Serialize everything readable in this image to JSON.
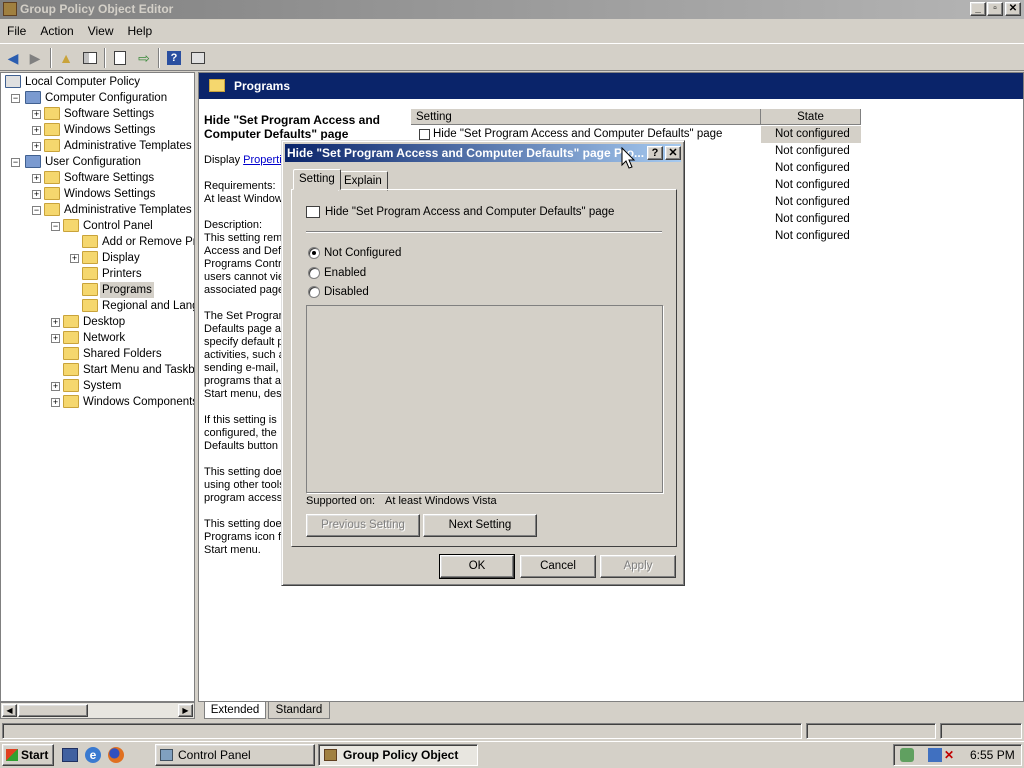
{
  "window": {
    "title": "Group Policy Object Editor",
    "min": "_",
    "max": "▫",
    "close": "✕"
  },
  "menu": [
    "File",
    "Action",
    "View",
    "Help"
  ],
  "tree": [
    {
      "label": "Local Computer Policy",
      "level": 0,
      "exp": ""
    },
    {
      "label": "Computer Configuration",
      "level": 1,
      "exp": "−"
    },
    {
      "label": "Software Settings",
      "level": 2,
      "exp": "+"
    },
    {
      "label": "Windows Settings",
      "level": 2,
      "exp": "+"
    },
    {
      "label": "Administrative Templates",
      "level": 2,
      "exp": "+"
    },
    {
      "label": "User Configuration",
      "level": 1,
      "exp": "−"
    },
    {
      "label": "Software Settings",
      "level": 2,
      "exp": "+"
    },
    {
      "label": "Windows Settings",
      "level": 2,
      "exp": "+"
    },
    {
      "label": "Administrative Templates",
      "level": 2,
      "exp": "−"
    },
    {
      "label": "Control Panel",
      "level": 3,
      "exp": "−"
    },
    {
      "label": "Add or Remove Pro",
      "level": 4,
      "exp": ""
    },
    {
      "label": "Display",
      "level": 4,
      "exp": "+"
    },
    {
      "label": "Printers",
      "level": 4,
      "exp": ""
    },
    {
      "label": "Programs",
      "level": 4,
      "exp": "",
      "selected": true
    },
    {
      "label": "Regional and Langu",
      "level": 4,
      "exp": ""
    },
    {
      "label": "Desktop",
      "level": 3,
      "exp": "+"
    },
    {
      "label": "Network",
      "level": 3,
      "exp": "+"
    },
    {
      "label": "Shared Folders",
      "level": 3,
      "exp": ""
    },
    {
      "label": "Start Menu and Taskba",
      "level": 3,
      "exp": ""
    },
    {
      "label": "System",
      "level": 3,
      "exp": "+"
    },
    {
      "label": "Windows Components",
      "level": 3,
      "exp": "+"
    }
  ],
  "pane": {
    "header": "Programs",
    "desc_title": "Hide \"Set Program Access and Computer Defaults\" page",
    "display_prefix": "Display ",
    "display_link": "Properti",
    "requirements_label": "Requirements:",
    "requirements_value": "At least Window",
    "description_label": "Description:",
    "desc_lines_1": [
      "This setting rem",
      "Access and Defa",
      "Programs Contro",
      "users cannot vie",
      "associated page"
    ],
    "desc_lines_2": [
      "The Set Program",
      "Defaults page al",
      "specify default p",
      "activities, such a",
      "sending e-mail, a",
      "programs that a",
      "Start menu, des"
    ],
    "desc_lines_3": [
      "If this setting is",
      "configured, the",
      "Defaults button"
    ],
    "desc_lines_4": [
      "This setting doe",
      "using other tools",
      "program access"
    ],
    "desc_lines_5": [
      "This setting doe",
      "Programs icon fr",
      "Start menu."
    ],
    "col_setting": "Setting",
    "col_state": "State",
    "rows": [
      {
        "setting": "Hide \"Set Program Access and Computer Defaults\" page",
        "state": "Not configured"
      },
      {
        "setting": "",
        "state": "Not configured"
      },
      {
        "setting": "",
        "state": "Not configured"
      },
      {
        "setting": "",
        "state": "Not configured"
      },
      {
        "setting": "",
        "state": "Not configured"
      },
      {
        "setting": "",
        "state": "Not configured"
      },
      {
        "setting": "",
        "state": "Not configured"
      }
    ]
  },
  "tabs_bottom": [
    "Extended",
    "Standard"
  ],
  "dialog": {
    "title": "Hide \"Set Program Access and Computer Defaults\" page Pro...",
    "help": "?",
    "close": "✕",
    "tabs": [
      "Setting",
      "Explain"
    ],
    "setting_name": "Hide \"Set Program Access and Computer Defaults\" page",
    "options": [
      "Not Configured",
      "Enabled",
      "Disabled"
    ],
    "selected_option": "Not Configured",
    "supported_label": "Supported on:",
    "supported_value": "At least Windows Vista",
    "prev": "Previous Setting",
    "next": "Next Setting",
    "ok": "OK",
    "cancel": "Cancel",
    "apply": "Apply"
  },
  "taskbar": {
    "start": "Start",
    "tasks": [
      "Control Panel",
      "Group Policy Object E..."
    ],
    "clock": "6:55 PM"
  }
}
